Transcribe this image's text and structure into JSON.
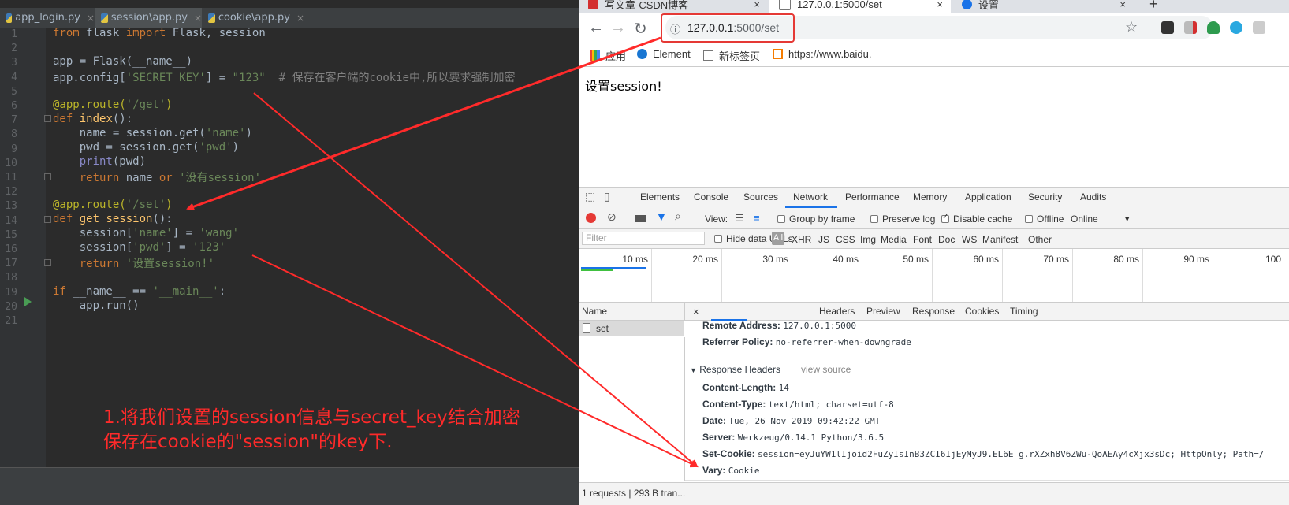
{
  "ide": {
    "tabs": [
      {
        "label": "app_login.py"
      },
      {
        "label": "session\\app.py"
      },
      {
        "label": "cookie\\app.py"
      }
    ],
    "tab_close": "×",
    "line_numbers": [
      "1",
      "2",
      "3",
      "4",
      "5",
      "6",
      "7",
      "8",
      "9",
      "10",
      "11",
      "12",
      "13",
      "14",
      "15",
      "16",
      "17",
      "18",
      "19",
      "20",
      "21"
    ],
    "code": {
      "l1": {
        "kw": "from",
        "a": " flask ",
        "kw2": "import",
        "b": " Flask, session"
      },
      "l3": "app = Flask(__name__)",
      "l4": {
        "a": "app.config[",
        "s1": "'SECRET_KEY'",
        "b": "] = ",
        "s2": "\"123\"",
        "c": "  ",
        "cm": "# 保存在客户端的cookie中,所以要求强制加密"
      },
      "l6": {
        "dec": "@app.route(",
        "s": "'/get'",
        "e": ")"
      },
      "l7": {
        "kw": "def",
        "fn": " index",
        "e": "():"
      },
      "l8": {
        "a": "    name = session.get(",
        "s": "'name'",
        "e": ")"
      },
      "l9": {
        "a": "    pwd = session.get(",
        "s": "'pwd'",
        "e": ")"
      },
      "l10": {
        "bi": "    print",
        "e": "(pwd)"
      },
      "l11": {
        "kw": "    return",
        "a": " name ",
        "kw2": "or",
        "s": " '没有session'"
      },
      "l13": {
        "dec": "@app.route(",
        "s": "'/set'",
        "e": ")"
      },
      "l14": {
        "kw": "def",
        "fn": " get_session",
        "e": "():"
      },
      "l15": {
        "a": "    session[",
        "s1": "'name'",
        "b": "] = ",
        "s2": "'wang'"
      },
      "l16": {
        "a": "    session[",
        "s1": "'pwd'",
        "b": "] = ",
        "s2": "'123'"
      },
      "l17": {
        "kw": "    return",
        "s": " '设置session!'"
      },
      "l19": {
        "kw": "if",
        "a": " __name__ == ",
        "s": "'__main__'",
        "e": ":"
      },
      "l20": "    app.run()"
    },
    "annotation_line1": "1.将我们设置的session信息与secret_key结合加密",
    "annotation_line2": "保存在cookie的\"session\"的key下."
  },
  "browser": {
    "tabs": [
      {
        "label": "写文章-CSDN博客"
      },
      {
        "label": "127.0.0.1:5000/set"
      },
      {
        "label": "设置"
      }
    ],
    "new_tab": "+",
    "tab_close": "×",
    "url_host": "127.0.0.1",
    "url_path": ":5000/set",
    "bookmarks": [
      "应用",
      "Element",
      "新标签页",
      "https://www.baidu."
    ],
    "page_text": "设置session!",
    "colors": {
      "accent": "#1a73e8",
      "annotation_red": "#ff2a2a"
    }
  },
  "devtools": {
    "tabs": [
      "Elements",
      "Console",
      "Sources",
      "Network",
      "Performance",
      "Memory",
      "Application",
      "Security",
      "Audits"
    ],
    "toolbar": {
      "view": "View:",
      "group_by_frame": "Group by frame",
      "preserve_log": "Preserve log",
      "disable_cache": "Disable cache",
      "offline": "Offline",
      "online": "Online"
    },
    "filter_placeholder": "Filter",
    "hide_data_urls": "Hide data URLs",
    "filter_types": [
      "All",
      "XHR",
      "JS",
      "CSS",
      "Img",
      "Media",
      "Font",
      "Doc",
      "WS",
      "Manifest",
      "Other"
    ],
    "timeline_labels": [
      "10 ms",
      "20 ms",
      "30 ms",
      "40 ms",
      "50 ms",
      "60 ms",
      "70 ms",
      "80 ms",
      "90 ms",
      "100"
    ],
    "name_header": "Name",
    "request_name": "set",
    "detail_tabs": [
      "Headers",
      "Preview",
      "Response",
      "Cookies",
      "Timing"
    ],
    "status": "1 requests | 293 B tran...",
    "general": {
      "remote_address_k": "Remote Address:",
      "remote_address_v": "127.0.0.1:5000",
      "referrer_policy_k": "Referrer Policy:",
      "referrer_policy_v": "no-referrer-when-downgrade"
    },
    "response_headers_title": "Response Headers",
    "view_source": "view source",
    "response_headers": [
      {
        "k": "Content-Length:",
        "v": "14"
      },
      {
        "k": "Content-Type:",
        "v": "text/html; charset=utf-8"
      },
      {
        "k": "Date:",
        "v": "Tue, 26 Nov 2019 09:42:22 GMT"
      },
      {
        "k": "Server:",
        "v": "Werkzeug/0.14.1 Python/3.6.5"
      },
      {
        "k": "Set-Cookie:",
        "v": "session=eyJuYW1lIjoid2FuZyIsInB3ZCI6IjEyMyJ9.EL6E_g.rXZxh8V6ZWu-QoAEAy4cXjx3sDc; HttpOnly; Path=/"
      },
      {
        "k": "Vary:",
        "v": "Cookie"
      }
    ]
  }
}
